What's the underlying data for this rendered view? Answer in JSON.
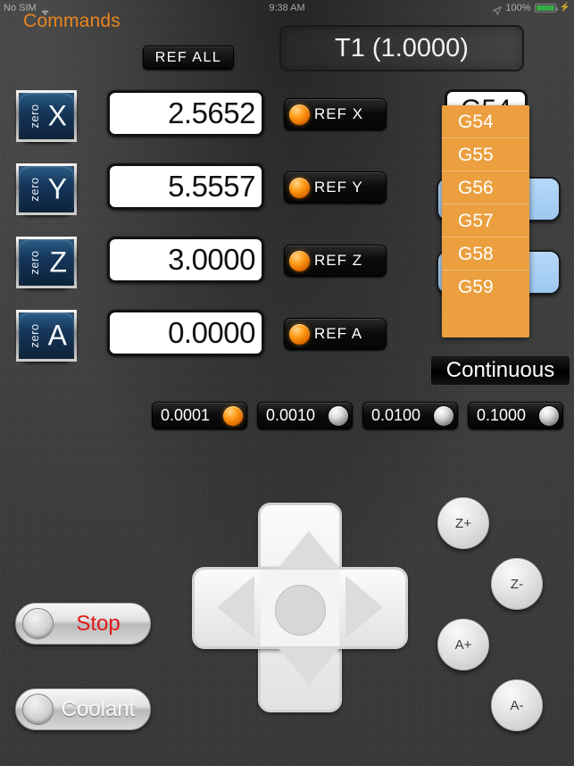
{
  "status_bar": {
    "carrier": "No SIM",
    "wifi_icon": "wifi-icon",
    "time": "9:38 AM",
    "location_icon": "location-arrow-icon",
    "battery_percent": "100%",
    "battery_icon": "battery-full-icon",
    "charging_icon": "lightning-bolt-icon"
  },
  "header": {
    "title": "Commands",
    "title_color": "#e8861f",
    "ref_all_label": "REF  ALL",
    "tool_label": "T1 (1.0000)"
  },
  "axes": [
    {
      "zero_label": "zero",
      "letter": "X",
      "value": "2.5652",
      "ref_label": "REF  X",
      "ref_active": true
    },
    {
      "zero_label": "zero",
      "letter": "Y",
      "value": "5.5557",
      "ref_label": "REF  Y",
      "ref_active": true
    },
    {
      "zero_label": "zero",
      "letter": "Z",
      "value": "3.0000",
      "ref_label": "REF  Z",
      "ref_active": true
    },
    {
      "zero_label": "zero",
      "letter": "A",
      "value": "0.0000",
      "ref_label": "REF  A",
      "ref_active": true
    }
  ],
  "work_offset": {
    "selected": "G54",
    "picker_open": true,
    "picker_color": "#eb9f3e",
    "options": [
      "G54",
      "G55",
      "G56",
      "G57",
      "G58",
      "G59"
    ]
  },
  "jog_mode": {
    "label": "Continuous"
  },
  "step_buttons": [
    {
      "label": "0.0001",
      "active": true
    },
    {
      "label": "0.0010",
      "active": false
    },
    {
      "label": "0.0100",
      "active": false
    },
    {
      "label": "0.1000",
      "active": false
    }
  ],
  "dpad": {
    "up_icon": "triangle-up-icon",
    "down_icon": "triangle-down-icon",
    "left_icon": "triangle-left-icon",
    "right_icon": "triangle-right-icon",
    "center_icon": "circle-icon"
  },
  "axis_buttons": [
    {
      "label": "Z+"
    },
    {
      "label": "Z-"
    },
    {
      "label": "A+"
    },
    {
      "label": "A-"
    }
  ],
  "control_buttons": [
    {
      "label": "Stop",
      "color": "#e01818"
    },
    {
      "label": "Coolant",
      "color": "#fbfbfb"
    }
  ]
}
